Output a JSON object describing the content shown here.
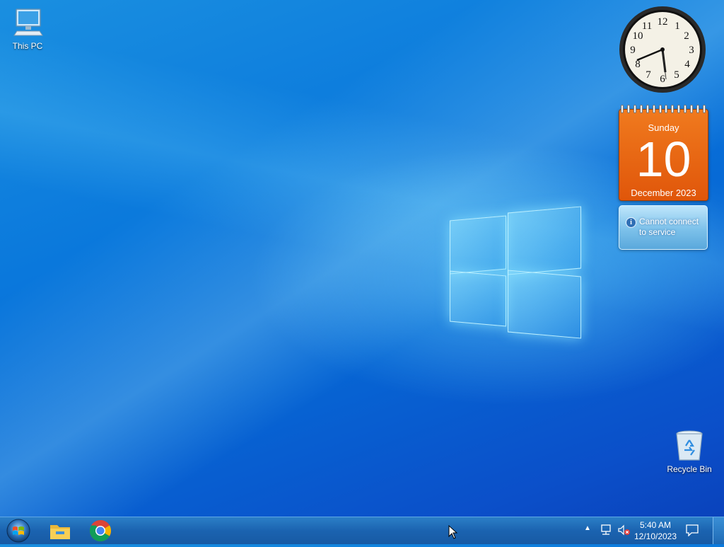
{
  "desktop": {
    "icons": [
      {
        "label": "This PC",
        "icon": "computer-icon"
      },
      {
        "label": "Recycle Bin",
        "icon": "recycle-bin-icon"
      }
    ]
  },
  "gadgets": {
    "clock": {
      "numerals": [
        "12",
        "1",
        "2",
        "3",
        "4",
        "5",
        "6",
        "7",
        "8",
        "9",
        "10",
        "11"
      ],
      "time": "5:40"
    },
    "calendar": {
      "weekday": "Sunday",
      "day": "10",
      "month_year": "December 2023"
    },
    "weather": {
      "message": "Cannot connect to service",
      "icon": "info-icon"
    }
  },
  "taskbar": {
    "start_icon": "windows-start-orb-icon",
    "pinned": [
      {
        "name": "File Explorer",
        "icon": "folder-icon"
      },
      {
        "name": "Google Chrome",
        "icon": "chrome-icon"
      }
    ],
    "tray": {
      "time": "5:40 AM",
      "date": "12/10/2023",
      "chevron": "▲"
    }
  },
  "colors": {
    "taskbar": "#1b63b0",
    "calendar_orange": "#e8661a",
    "desktop_blue": "#0a78dc"
  }
}
